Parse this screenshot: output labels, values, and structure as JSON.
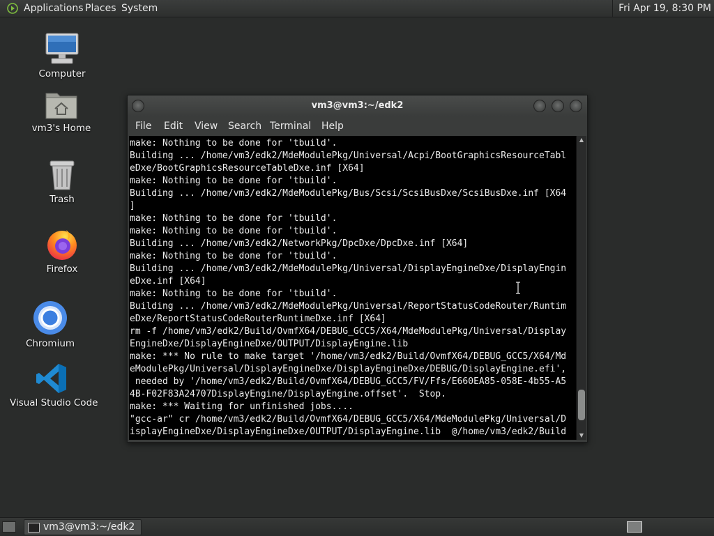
{
  "top_panel": {
    "menus": [
      "Applications",
      "Places",
      "System"
    ],
    "clock": "Fri Apr 19,  8:30 PM"
  },
  "desktop_icons": [
    {
      "label": "Computer",
      "icon": "computer-icon"
    },
    {
      "label": "vm3's Home",
      "icon": "home-folder-icon"
    },
    {
      "label": "Trash",
      "icon": "trash-icon"
    },
    {
      "label": "Firefox",
      "icon": "firefox-icon"
    },
    {
      "label": "Chromium",
      "icon": "chromium-icon"
    },
    {
      "label": "Visual Studio Code",
      "icon": "vscode-icon"
    }
  ],
  "window": {
    "title": "vm3@vm3:~/edk2",
    "menu": [
      "File",
      "Edit",
      "View",
      "Search",
      "Terminal",
      "Help"
    ],
    "terminal_lines": [
      "make: Nothing to be done for 'tbuild'.",
      "Building ... /home/vm3/edk2/MdeModulePkg/Universal/Acpi/BootGraphicsResourceTabl",
      "eDxe/BootGraphicsResourceTableDxe.inf [X64]",
      "make: Nothing to be done for 'tbuild'.",
      "Building ... /home/vm3/edk2/MdeModulePkg/Bus/Scsi/ScsiBusDxe/ScsiBusDxe.inf [X64",
      "]",
      "make: Nothing to be done for 'tbuild'.",
      "make: Nothing to be done for 'tbuild'.",
      "Building ... /home/vm3/edk2/NetworkPkg/DpcDxe/DpcDxe.inf [X64]",
      "make: Nothing to be done for 'tbuild'.",
      "Building ... /home/vm3/edk2/MdeModulePkg/Universal/DisplayEngineDxe/DisplayEngin",
      "eDxe.inf [X64]",
      "make: Nothing to be done for 'tbuild'.",
      "Building ... /home/vm3/edk2/MdeModulePkg/Universal/ReportStatusCodeRouter/Runtim",
      "eDxe/ReportStatusCodeRouterRuntimeDxe.inf [X64]",
      "rm -f /home/vm3/edk2/Build/OvmfX64/DEBUG_GCC5/X64/MdeModulePkg/Universal/Display",
      "EngineDxe/DisplayEngineDxe/OUTPUT/DisplayEngine.lib",
      "make: *** No rule to make target '/home/vm3/edk2/Build/OvmfX64/DEBUG_GCC5/X64/Md",
      "eModulePkg/Universal/DisplayEngineDxe/DisplayEngineDxe/DEBUG/DisplayEngine.efi',",
      " needed by '/home/vm3/edk2/Build/OvmfX64/DEBUG_GCC5/FV/Ffs/E660EA85-058E-4b55-A5",
      "4B-F02F83A24707DisplayEngine/DisplayEngine.offset'.  Stop.",
      "make: *** Waiting for unfinished jobs....",
      "\"gcc-ar\" cr /home/vm3/edk2/Build/OvmfX64/DEBUG_GCC5/X64/MdeModulePkg/Universal/D",
      "isplayEngineDxe/DisplayEngineDxe/OUTPUT/DisplayEngine.lib  @/home/vm3/edk2/Build"
    ]
  },
  "taskbar": {
    "task_label": "vm3@vm3:~/edk2"
  }
}
